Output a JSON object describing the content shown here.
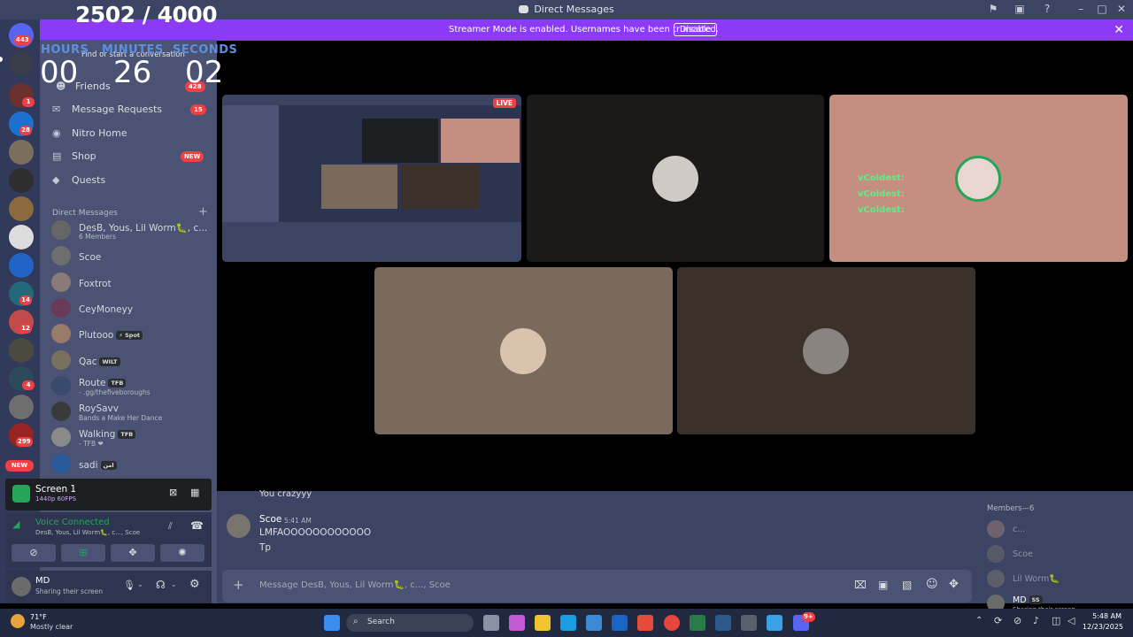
{
  "window": {
    "title": "Direct Messages"
  },
  "banner": {
    "text": "Streamer Mode is enabled. Usernames have been truncated.",
    "disable_label": "Disable"
  },
  "counter": {
    "text": "2502 / 4000"
  },
  "timer": {
    "hours_label": "HOURS",
    "minutes_label": "MINUTES",
    "seconds_label": "SECONDS",
    "hours": "00",
    "minutes": "26",
    "seconds": "02"
  },
  "servers": {
    "badges": [
      "443",
      "1",
      "28",
      "14",
      "12",
      "4",
      "299"
    ],
    "new_label": "NEW"
  },
  "sidebar": {
    "search_placeholder": "Find or start a conversation",
    "friends_label": "Friends",
    "friends_badge": "428",
    "message_requests_label": "Message Requests",
    "message_requests_badge": "15",
    "nitro_label": "Nitro Home",
    "shop_label": "Shop",
    "shop_badge": "NEW",
    "quests_label": "Quests",
    "dm_header": "Direct Messages",
    "dms": [
      {
        "name": "DesB, Yous, Lil Worm🐛, c...",
        "sub": "6 Members",
        "tag": ""
      },
      {
        "name": "Scoe",
        "sub": "",
        "tag": ""
      },
      {
        "name": "Foxtrot",
        "sub": "",
        "tag": ""
      },
      {
        "name": "CeyMoneyy",
        "sub": "",
        "tag": ""
      },
      {
        "name": "Plutooo",
        "sub": "",
        "tag": "⚡ Spot"
      },
      {
        "name": "Qac",
        "sub": "",
        "tag": "WILT"
      },
      {
        "name": "Route",
        "sub": "- .gg/thefiveboroughs",
        "tag": "TFB"
      },
      {
        "name": "RoySavv",
        "sub": "Bands a Make Her Dance",
        "tag": ""
      },
      {
        "name": "Walking",
        "sub": "- TFB ❤",
        "tag": "TFB"
      },
      {
        "name": "sadi",
        "sub": "",
        "tag": "امن"
      }
    ]
  },
  "stream": {
    "title": "Screen 1",
    "quality": "1440p 60FPS"
  },
  "voice": {
    "status": "Voice Connected",
    "channel": "DesB, Yous, Lil Worm🐛, c..., Scoe"
  },
  "user": {
    "name": "MD",
    "status": "Sharing their screen"
  },
  "video": {
    "live_label": "LIVE",
    "chat_overlay": [
      "vColdest:",
      "vColdest:",
      "vColdest:"
    ]
  },
  "chat": {
    "prev_message": "You crazyyy",
    "author": "Scoe",
    "time": "5:41 AM",
    "lines": [
      "LMFAOOOOOOOOOOOO",
      "Tp"
    ],
    "composer_placeholder": "Message DesB, Yous, Lil Worm🐛, c..., Scoe"
  },
  "members": {
    "header": "Members—6",
    "list": [
      {
        "name": "c...",
        "sub": ""
      },
      {
        "name": "Scoe",
        "sub": ""
      },
      {
        "name": "Lil Worm🐛",
        "sub": ""
      },
      {
        "name": "MD",
        "sub": "Sharing their screen",
        "tag": "SS"
      }
    ]
  },
  "taskbar": {
    "weather_temp": "71°F",
    "weather_desc": "Mostly clear",
    "search_label": "Search",
    "time": "5:48 AM",
    "date": "12/23/2025",
    "discord_badge": "9+"
  },
  "colors": {
    "brand": "#5865f2",
    "banner": "#8b3bf5",
    "live": "#ed4245",
    "online": "#23a55a",
    "timer_label": "#5d8ee0"
  }
}
